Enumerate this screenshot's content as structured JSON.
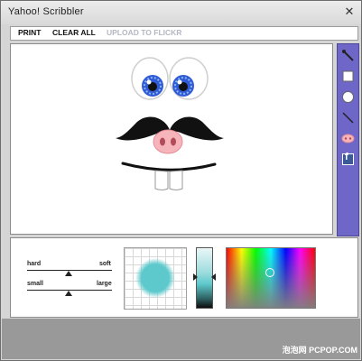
{
  "window": {
    "title": "Yahoo! Scribbler",
    "close_icon": "close-icon"
  },
  "menu": {
    "print": "PRINT",
    "clear_all": "CLEAR ALL",
    "upload": "UPLOAD TO FLICKR"
  },
  "tools": [
    "pen-icon",
    "square-icon",
    "circle-icon",
    "line-icon",
    "stamp-icon",
    "facebook-icon"
  ],
  "facebook_letter": "f",
  "sliders": {
    "top_left": "hard",
    "top_right": "soft",
    "bottom_left": "small",
    "bottom_right": "large"
  },
  "colors": {
    "toolbar": "#6f67c8",
    "brush": "#5ec9cc",
    "eye_iris": "#2f5bd6"
  },
  "watermark": "泡泡网 PCPOP.COM"
}
